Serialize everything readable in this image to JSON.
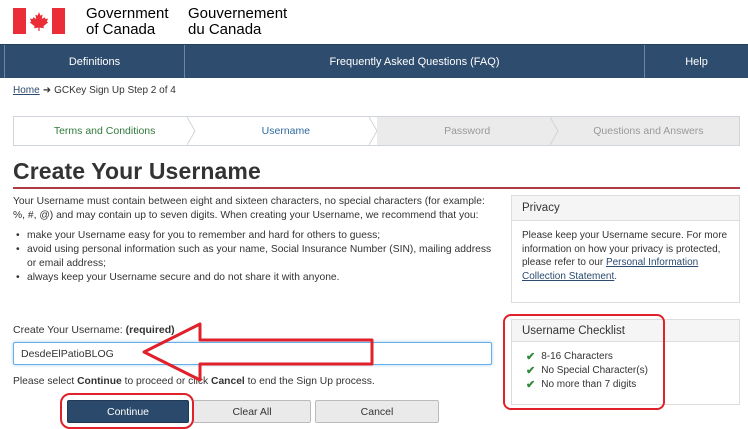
{
  "header": {
    "gov_en_line1": "Government",
    "gov_en_line2": "of Canada",
    "gov_fr_line1": "Gouvernement",
    "gov_fr_line2": "du Canada",
    "flag_icon": "canada-flag-icon"
  },
  "nav": {
    "definitions": "Definitions",
    "faq": "Frequently Asked Questions (FAQ)",
    "help": "Help"
  },
  "breadcrumb": {
    "home": "Home",
    "arrow": "➜",
    "current": "GCKey Sign Up Step 2 of 4"
  },
  "steps": [
    {
      "label": "Terms and Conditions",
      "state": "done"
    },
    {
      "label": "Username",
      "state": "active"
    },
    {
      "label": "Password",
      "state": "todo"
    },
    {
      "label": "Questions and Answers",
      "state": "todo"
    }
  ],
  "main": {
    "title": "Create Your Username",
    "intro": "Your Username must contain between eight and sixteen characters, no special characters (for example: %, #, @) and may contain up to seven digits. When creating your Username, we recommend that you:",
    "bullets": [
      "make your Username easy for you to remember and hard for others to guess;",
      "avoid using personal information such as your name, Social Insurance Number (SIN), mailing address or email address;",
      "always keep your Username secure and do not share it with anyone."
    ]
  },
  "privacy": {
    "heading": "Privacy",
    "body_text": "Please keep your Username secure. For more information on how your privacy is protected, please refer to our ",
    "link_text": "Personal Information Collection Statement",
    "body_end": "."
  },
  "checklist": {
    "heading": "Username Checklist",
    "items": [
      "8-16 Characters",
      "No Special Character(s)",
      "No more than 7 digits"
    ]
  },
  "form": {
    "label": "Create Your Username: ",
    "required": "(required)",
    "value": "DesdeElPatioBLOG",
    "instruction_pre": "Please select ",
    "instruction_continue": "Continue",
    "instruction_mid": " to proceed or click ",
    "instruction_cancel": "Cancel",
    "instruction_post": " to end the Sign Up process."
  },
  "buttons": {
    "continue": "Continue",
    "clear": "Clear All",
    "cancel": "Cancel"
  },
  "colors": {
    "nav_bg": "#2e4c6d",
    "accent_red": "#af3c43",
    "annotation_red": "#e0202a",
    "check_green": "#2f8a3a"
  }
}
